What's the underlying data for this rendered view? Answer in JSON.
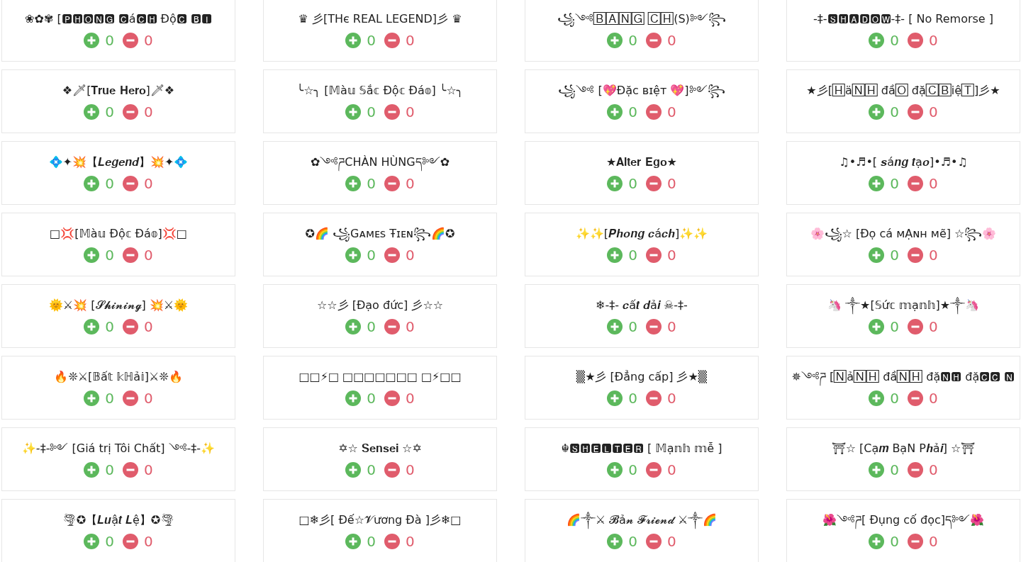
{
  "cards": [
    {
      "name": "❀✿✾ [🅿🅷🅾🅽🅶 🅲á🅲🅷 Độ🅲 🅱🅸",
      "likes": "0",
      "dislikes": "0"
    },
    {
      "name": "♛ 彡[THє REAL LEGEND]彡 ♛",
      "likes": "0",
      "dislikes": "0"
    },
    {
      "name": "꧁༺🄱🄰🄽🄶 🄲🄷(S)༻꧂",
      "likes": "0",
      "dislikes": "0"
    },
    {
      "name": "-‡-🆂🅷🅰🅳🅾🆆-‡- [ No Remorse ]",
      "likes": "0",
      "dislikes": "0"
    },
    {
      "name": "❖🗡[𝐓𝐫𝐮𝐞 𝐇𝐞𝐫𝐨]🗡❖",
      "likes": "0",
      "dislikes": "0"
    },
    {
      "name": "╰☆╮ [𝕄à𝕦 𝕊ắ𝕔 Độ𝕔 Đá𝕠] ╰☆╮",
      "likes": "0",
      "dislikes": "0"
    },
    {
      "name": "꧁༺ [💖Đặc ʙɪệᴛ 💖]༻꧂",
      "likes": "0",
      "dislikes": "0"
    },
    {
      "name": "★彡[🄷ä🄽🄷 đầ🄾 đặ🄲🄱iệ🅃]彡★",
      "likes": "0",
      "dislikes": "0"
    },
    {
      "name": "💠✦💥【𝑳𝒆𝒈𝒆𝒏𝒅】💥✦💠",
      "likes": "0",
      "dislikes": "0"
    },
    {
      "name": "✿༺ཌCHÀN HÙNGད༻✿",
      "likes": "0",
      "dislikes": "0"
    },
    {
      "name": "★𝐀𝐥𝐭𝐞𝐫 𝐄𝐠𝐨★",
      "likes": "0",
      "dislikes": "0"
    },
    {
      "name": "♫•♬•[ 𝒔á𝒏𝒈 𝒕ạ𝒐]•♬•♫",
      "likes": "0",
      "dislikes": "0"
    },
    {
      "name": "□💢[𝕄à𝕦 Độ𝕔 Đá𝕠]💢□",
      "likes": "0",
      "dislikes": "0"
    },
    {
      "name": "✪🌈 ꧁Gᴀᴍᴇꜱ Ŧɪᴇɴ꧂🌈✪",
      "likes": "0",
      "dislikes": "0"
    },
    {
      "name": "✨✨[𝑷𝒉𝒐𝒏𝒈 𝒄á𝒄𝒉]✨✨",
      "likes": "0",
      "dislikes": "0"
    },
    {
      "name": "🌸꧁☆ [Đọ cá ᴍẠɴʜ ᴍẽ] ☆꧂🌸",
      "likes": "0",
      "dislikes": "0"
    },
    {
      "name": "🌞⚔💥 [𝓢𝓱𝓲𝓷𝓲𝓷𝓰] 💥⚔🌞",
      "likes": "0",
      "dislikes": "0"
    },
    {
      "name": "☆☆彡 [Đạo đức] 彡☆☆",
      "likes": "0",
      "dislikes": "0"
    },
    {
      "name": "❄-‡- 𝒄ấ𝒕 𝒅ả𝒊 ☠-‡-",
      "likes": "0",
      "dislikes": "0"
    },
    {
      "name": "🦄 ༒★[𝕊ứ𝕔 𝕞ạ𝕟𝕙]★༒🦄",
      "likes": "0",
      "dislikes": "0"
    },
    {
      "name": "🔥❊⚔[𝔹ấ𝕥 𝕜ℍả𝕚]⚔❊🔥",
      "likes": "0",
      "dislikes": "0"
    },
    {
      "name": "□□⚡□ □□□□□□□ □⚡□□",
      "likes": "0",
      "dislikes": "0"
    },
    {
      "name": "▒★彡 [Đẳng cấp] 彡★▒",
      "likes": "0",
      "dislikes": "0"
    },
    {
      "name": "✵༺ཌ [🄽ả🄽🄷 đầ🄽🄷 đặ🅽🅷 đặ🅲🅲 🅽",
      "likes": "0",
      "dislikes": "0"
    },
    {
      "name": "✨-‡-༻ [Giá trị Tôi Chất] ༺-‡-✨",
      "likes": "0",
      "dislikes": "0"
    },
    {
      "name": "✡☆ 𝐒𝐞𝐧𝐬𝐞𝐢 ☆✡",
      "likes": "0",
      "dislikes": "0"
    },
    {
      "name": "☬🆂🅷🅴🅻🆃🅴🆁 [ 𝕄ạ𝕟𝕙 𝕞ễ ]",
      "likes": "0",
      "dislikes": "0"
    },
    {
      "name": "⛩☆ [Cạ𝒎 BạN P𝒉ả𝒊] ☆⛩",
      "likes": "0",
      "dislikes": "0"
    },
    {
      "name": "🌪✪【𝑳𝒖ậ𝒕 𝑳ệ】✪🌪",
      "likes": "0",
      "dislikes": "0"
    },
    {
      "name": "□❄彡[ Đế☆𝓥ương Đà ]彡❄□",
      "likes": "0",
      "dislikes": "0"
    },
    {
      "name": "🌈༒⚔ 𝓑ả𝓷 𝓕𝓻𝓲𝓮𝓷𝓭 ⚔༒🌈",
      "likes": "0",
      "dislikes": "0"
    },
    {
      "name": "🌺༺ཌ[ Đụng cố đọc]ད༻🌺",
      "likes": "0",
      "dislikes": "0"
    }
  ]
}
